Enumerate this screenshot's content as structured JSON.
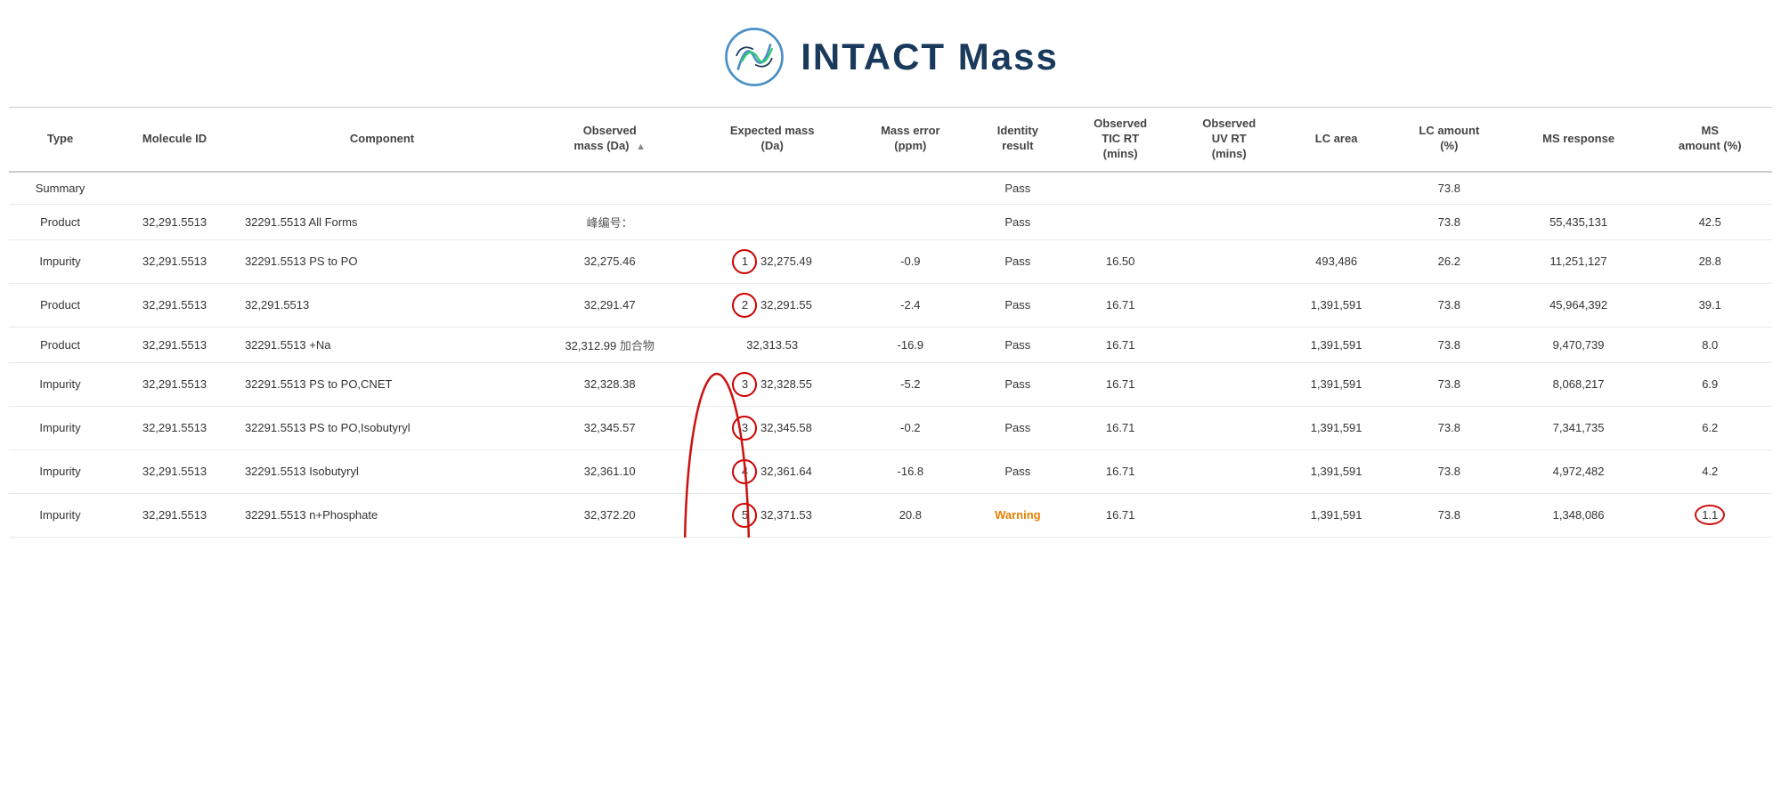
{
  "brand": {
    "name_regular": "INTACT ",
    "name_bold": "Mass"
  },
  "table": {
    "columns": [
      {
        "id": "type",
        "label": "Type"
      },
      {
        "id": "molecule_id",
        "label": "Molecule ID"
      },
      {
        "id": "component",
        "label": "Component"
      },
      {
        "id": "observed_mass",
        "label": "Observed\nmass (Da)",
        "sortable": true
      },
      {
        "id": "expected_mass",
        "label": "Expected mass\n(Da)"
      },
      {
        "id": "mass_error",
        "label": "Mass error\n(ppm)"
      },
      {
        "id": "identity_result",
        "label": "Identity\nresult"
      },
      {
        "id": "observed_tic_rt",
        "label": "Observed\nTIC RT\n(mins)"
      },
      {
        "id": "observed_uv_rt",
        "label": "Observed\nUV RT\n(mins)"
      },
      {
        "id": "lc_area",
        "label": "LC area"
      },
      {
        "id": "lc_amount",
        "label": "LC amount\n(%)"
      },
      {
        "id": "ms_response",
        "label": "MS response"
      },
      {
        "id": "ms_amount",
        "label": "MS\namount (%)"
      }
    ],
    "summary_row": {
      "type": "Summary",
      "identity_result": "Pass",
      "lc_amount": "73.8"
    },
    "rows": [
      {
        "type": "Product",
        "molecule_id": "32,291.5513",
        "component": "32291.5513 All Forms",
        "observed_mass": "",
        "peak_label": "峰编号：",
        "expected_mass": "",
        "mass_error": "",
        "identity_result": "Pass",
        "observed_tic_rt": "",
        "observed_uv_rt": "",
        "lc_area": "",
        "lc_amount": "73.8",
        "ms_response": "55,435,131",
        "ms_amount": "42.5",
        "peak_number": null,
        "is_adduct": false
      },
      {
        "type": "Impurity",
        "molecule_id": "32,291.5513",
        "component": "32291.5513 PS to PO",
        "observed_mass": "32,275.46",
        "expected_mass": "32,275.49",
        "mass_error": "-0.9",
        "identity_result": "Pass",
        "observed_tic_rt": "16.50",
        "observed_uv_rt": "",
        "lc_area": "493,486",
        "lc_amount": "26.2",
        "ms_response": "11,251,127",
        "ms_amount": "28.8",
        "peak_number": "1",
        "is_adduct": false
      },
      {
        "type": "Product",
        "molecule_id": "32,291.5513",
        "component": "32,291.5513",
        "observed_mass": "32,291.47",
        "expected_mass": "32,291.55",
        "mass_error": "-2.4",
        "identity_result": "Pass",
        "observed_tic_rt": "16.71",
        "observed_uv_rt": "",
        "lc_area": "1,391,591",
        "lc_amount": "73.8",
        "ms_response": "45,964,392",
        "ms_amount": "39.1",
        "peak_number": "2",
        "is_adduct": false
      },
      {
        "type": "Product",
        "molecule_id": "32,291.5513",
        "component": "32291.5513 +Na",
        "observed_mass": "32,312.99",
        "expected_mass": "32,313.53",
        "mass_error": "-16.9",
        "identity_result": "Pass",
        "observed_tic_rt": "16.71",
        "observed_uv_rt": "",
        "lc_area": "1,391,591",
        "lc_amount": "73.8",
        "ms_response": "9,470,739",
        "ms_amount": "8.0",
        "peak_number": null,
        "is_adduct": true,
        "adduct_label": "加合物"
      },
      {
        "type": "Impurity",
        "molecule_id": "32,291.5513",
        "component": "32291.5513 PS to PO,CNET",
        "observed_mass": "32,328.38",
        "expected_mass": "32,328.55",
        "mass_error": "-5.2",
        "identity_result": "Pass",
        "observed_tic_rt": "16.71",
        "observed_uv_rt": "",
        "lc_area": "1,391,591",
        "lc_amount": "73.8",
        "ms_response": "8,068,217",
        "ms_amount": "6.9",
        "peak_number": "3",
        "is_adduct": false
      },
      {
        "type": "Impurity",
        "molecule_id": "32,291.5513",
        "component": "32291.5513 PS to PO,Isobutyryl",
        "observed_mass": "32,345.57",
        "expected_mass": "32,345.58",
        "mass_error": "-0.2",
        "identity_result": "Pass",
        "observed_tic_rt": "16.71",
        "observed_uv_rt": "",
        "lc_area": "1,391,591",
        "lc_amount": "73.8",
        "ms_response": "7,341,735",
        "ms_amount": "6.2",
        "peak_number": "3",
        "is_adduct": false
      },
      {
        "type": "Impurity",
        "molecule_id": "32,291.5513",
        "component": "32291.5513 Isobutyryl",
        "observed_mass": "32,361.10",
        "expected_mass": "32,361.64",
        "mass_error": "-16.8",
        "identity_result": "Pass",
        "observed_tic_rt": "16.71",
        "observed_uv_rt": "",
        "lc_area": "1,391,591",
        "lc_amount": "73.8",
        "ms_response": "4,972,482",
        "ms_amount": "4.2",
        "peak_number": "4",
        "is_adduct": false
      },
      {
        "type": "Impurity",
        "molecule_id": "32,291.5513",
        "component": "32291.5513 n+Phosphate",
        "observed_mass": "32,372.20",
        "expected_mass": "32,371.53",
        "mass_error": "20.8",
        "identity_result": "Warning",
        "observed_tic_rt": "16.71",
        "observed_uv_rt": "",
        "lc_area": "1,391,591",
        "lc_amount": "73.8",
        "ms_response": "1,348,086",
        "ms_amount": "1.1",
        "ms_amount_circled": true,
        "peak_number": "5",
        "is_adduct": false
      }
    ]
  }
}
